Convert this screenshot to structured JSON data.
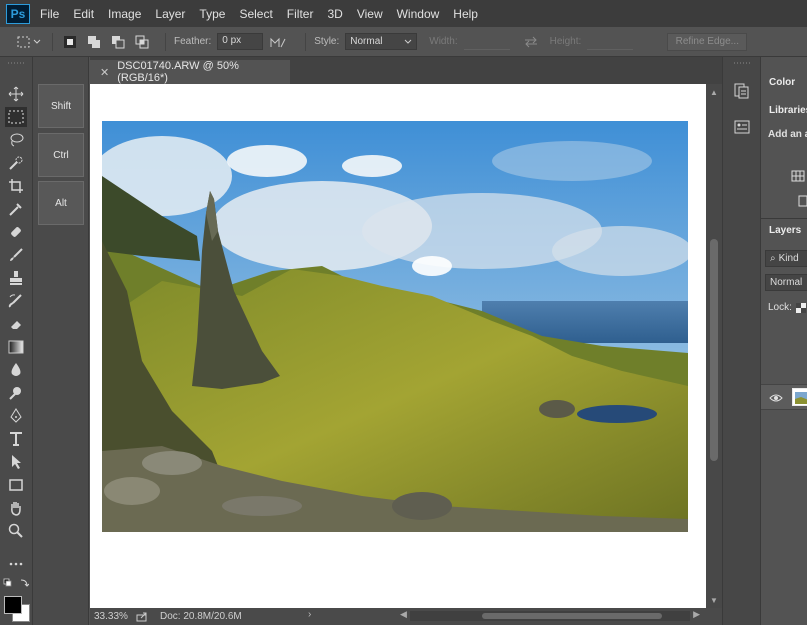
{
  "app": {
    "logo_text": "Ps"
  },
  "menu": [
    "File",
    "Edit",
    "Image",
    "Layer",
    "Type",
    "Select",
    "Filter",
    "3D",
    "View",
    "Window",
    "Help"
  ],
  "options": {
    "feather_label": "Feather:",
    "feather_value": "0 px",
    "style_label": "Style:",
    "style_value": "Normal",
    "width_label": "Width:",
    "height_label": "Height:",
    "refine_label": "Refine Edge..."
  },
  "touch_keys": [
    "Shift",
    "Ctrl",
    "Alt"
  ],
  "document": {
    "tab_title": "DSC01740.ARW @ 50% (RGB/16*)"
  },
  "status": {
    "zoom": "33.33%",
    "doc_info": "Doc: 20.8M/20.6M"
  },
  "panels": {
    "color_tab": "Color",
    "libraries_tab": "Libraries",
    "libraries_hint": "Add an a",
    "layers_tab": "Layers",
    "kind_label": "Kind",
    "blend_mode": "Normal",
    "lock_label": "Lock:"
  },
  "icons": {
    "tools": [
      "move-icon",
      "marquee-icon",
      "lasso-icon",
      "quick-select-icon",
      "crop-icon",
      "eyedropper-icon",
      "healing-brush-icon",
      "brush-icon",
      "clone-stamp-icon",
      "history-brush-icon",
      "eraser-icon",
      "gradient-icon",
      "blur-icon",
      "dodge-icon",
      "pen-icon",
      "type-icon",
      "path-select-icon",
      "rectangle-icon",
      "hand-icon",
      "zoom-icon"
    ]
  }
}
